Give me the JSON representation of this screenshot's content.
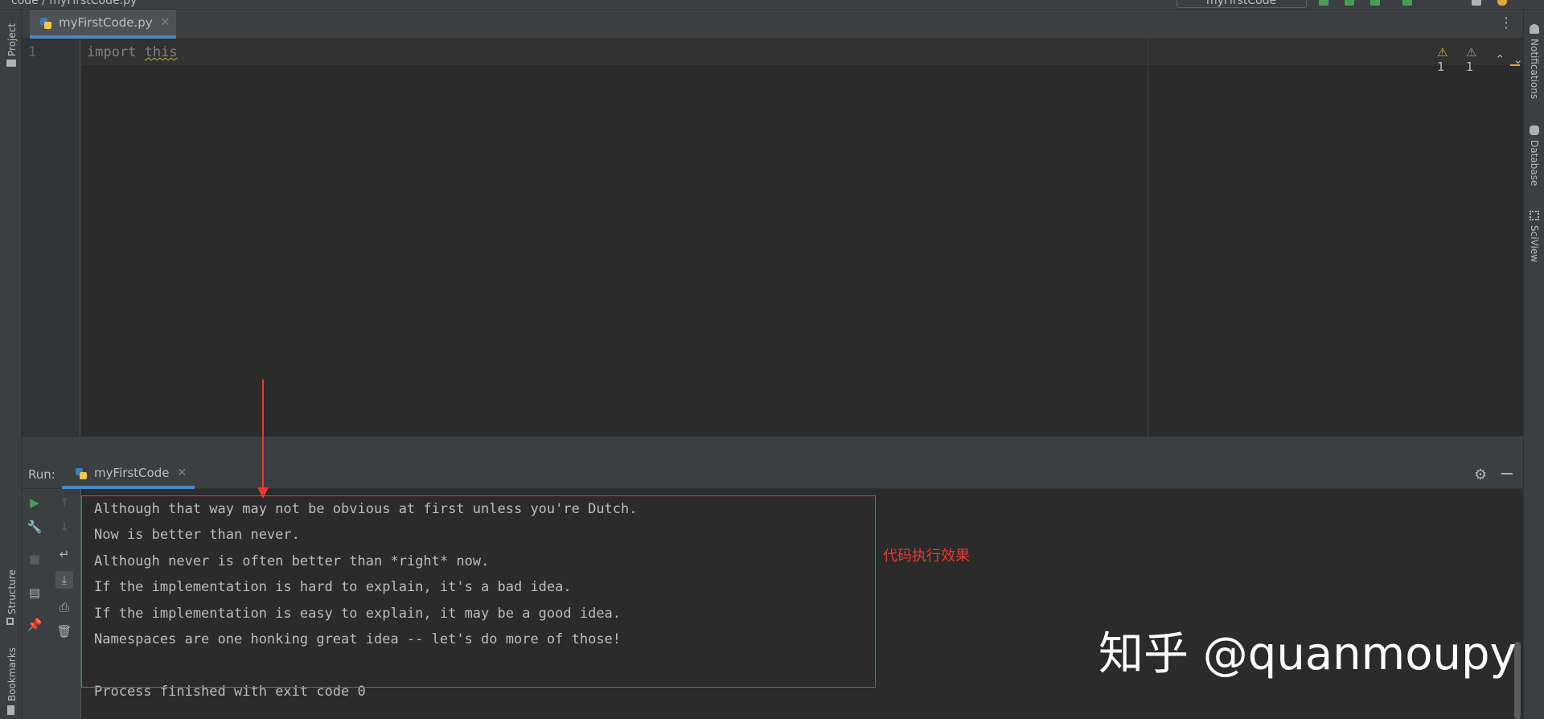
{
  "window": {
    "breadcrumb_root": "code",
    "breadcrumb_file": "myFirstCode.py",
    "run_config": "myFirstCode"
  },
  "left_stripe": {
    "project_label": "Project",
    "structure_label": "Structure",
    "bookmarks_label": "Bookmarks"
  },
  "right_stripe": {
    "notifications_label": "Notifications",
    "database_label": "Database",
    "sciview_label": "SciView"
  },
  "editor": {
    "tab_label": "myFirstCode.py",
    "line_number": "1",
    "code_keyword": "import",
    "code_identifier": "this",
    "warnings_count": "1",
    "weak_warnings_count": "1"
  },
  "run": {
    "label": "Run:",
    "tab_label": "myFirstCode"
  },
  "console": {
    "lines": [
      "Although that way may not be obvious at first unless you're Dutch.",
      "Now is better than never.",
      "Although never is often better than *right* now.",
      "If the implementation is hard to explain, it's a bad idea.",
      "If the implementation is easy to explain, it may be a good idea.",
      "Namespaces are one honking great idea -- let's do more of those!",
      "",
      "Process finished with exit code 0"
    ]
  },
  "annotation": {
    "text": "代码执行效果",
    "color": "#e53935"
  },
  "watermark": {
    "text": "知乎 @quanmoupy"
  },
  "colors": {
    "background": "#2b2b2b",
    "panel": "#3c3f41",
    "accent": "#4a88c7",
    "warning": "#e0a83a",
    "run_green": "#499c54"
  },
  "icons": {
    "run": "play-icon",
    "wrench": "wrench-icon",
    "stop": "stop-icon",
    "layout": "layout-icon",
    "pin": "pin-icon",
    "up": "arrow-up-icon",
    "down": "arrow-down-icon",
    "softwrap": "soft-wrap-icon",
    "scroll_end": "scroll-to-end-icon",
    "print": "print-icon",
    "trash": "trash-icon",
    "settings": "gear-icon"
  }
}
